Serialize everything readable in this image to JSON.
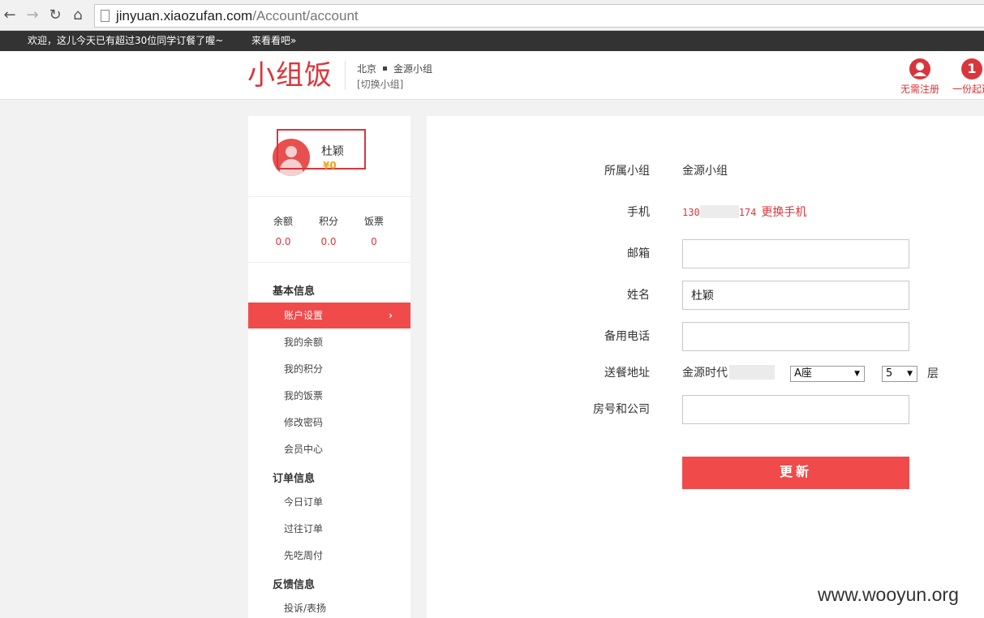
{
  "browser": {
    "url_host": "jinyuan.xiaozufan.com",
    "url_path": "/Account/account"
  },
  "notice": {
    "text": "欢迎，这儿今天已有超过30位同学订餐了喔~",
    "link": "来看看吧»"
  },
  "header": {
    "logo": "小组饭",
    "city": "北京",
    "group": "金源小组",
    "switch_group": "[切换小组]",
    "badge_register_label": "无需注册",
    "badge_register_icon": "user-icon",
    "badge_onemeal_label": "一份起送",
    "badge_onemeal_number": "1"
  },
  "user": {
    "name": "杜颖",
    "money": "¥0"
  },
  "stats": {
    "balance_label": "余额",
    "balance_value": "0.0",
    "points_label": "积分",
    "points_value": "0.0",
    "tickets_label": "饭票",
    "tickets_value": "0"
  },
  "sidebar": {
    "section_basic": "基本信息",
    "basic_items": [
      "账户设置",
      "我的余额",
      "我的积分",
      "我的饭票",
      "修改密码",
      "会员中心"
    ],
    "section_orders": "订单信息",
    "order_items": [
      "今日订单",
      "过往订单",
      "先吃周付"
    ],
    "section_feedback": "反馈信息",
    "feedback_items": [
      "投诉/表扬"
    ],
    "active_chevron": "›"
  },
  "form": {
    "group_label": "所属小组",
    "group_value": "金源小组",
    "phone_label": "手机",
    "phone_prefix": "130",
    "phone_suffix": "174",
    "change_phone": "更换手机",
    "email_label": "邮箱",
    "email_value": "",
    "name_label": "姓名",
    "name_value": "杜颖",
    "alt_phone_label": "备用电话",
    "alt_phone_value": "",
    "address_label": "送餐地址",
    "address_prefix": "金源时代",
    "building_selected": "A座",
    "floor_selected": "5",
    "floor_unit": "层",
    "room_label": "房号和公司",
    "room_value": "",
    "submit_label": "更新"
  },
  "watermark": "www.wooyun.org",
  "colors": {
    "accent": "#f04a4b",
    "brand_red": "#d9363b",
    "money": "#f0a020"
  }
}
